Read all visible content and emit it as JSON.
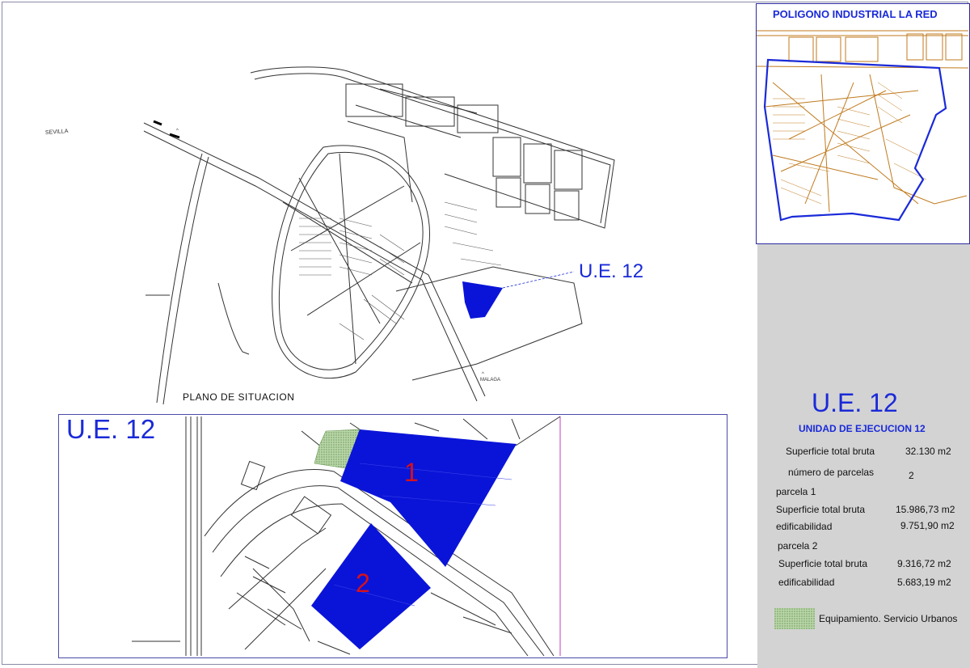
{
  "colors": {
    "site_blue": "#0a14d8",
    "label_blue": "#1a2ad8",
    "parcel_label_red": "#d8101a",
    "equipment_green": "#9ac28a",
    "inset_orange": "#c07a1e",
    "panel_gray": "#d3d3d3"
  },
  "inset_map": {
    "title": "POLIGONO INDUSTRIAL LA RED"
  },
  "situation_plan": {
    "label": "PLANO DE SITUACION",
    "site_callout": "U.E. 12",
    "road_label_north": "SEVILLA",
    "road_label_south": "MALAGA"
  },
  "detail_plan": {
    "title": "U.E. 12",
    "parcel_labels": [
      "1",
      "2"
    ]
  },
  "info_panel": {
    "title": "U.E. 12",
    "subtitle": "UNIDAD DE EJECUCION 12",
    "gross_area_label": "Superficie total bruta",
    "gross_area_value": "32.130 m2",
    "num_parcels_label": "número de parcelas",
    "num_parcels_value": "2",
    "parcels": [
      {
        "heading": "parcela 1",
        "gross_area_label": "Superficie total bruta",
        "gross_area_value": "15.986,73 m2",
        "buildability_label": "edificabilidad",
        "buildability_value": "9.751,90 m2"
      },
      {
        "heading": "parcela 2",
        "gross_area_label": "Superficie total bruta",
        "gross_area_value": "9.316,72 m2",
        "buildability_label": "edificabilidad",
        "buildability_value": "5.683,19 m2"
      }
    ],
    "legend_label": "Equipamiento. Servicio Urbanos"
  }
}
